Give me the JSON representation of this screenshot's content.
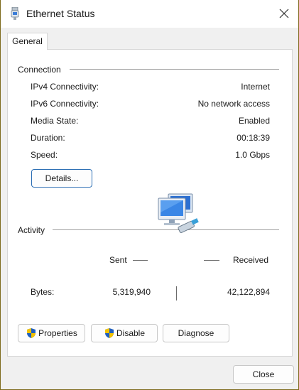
{
  "window": {
    "title": "Ethernet Status"
  },
  "tabs": [
    {
      "label": "General"
    }
  ],
  "connection": {
    "heading": "Connection",
    "rows": [
      {
        "label": "IPv4 Connectivity:",
        "value": "Internet"
      },
      {
        "label": "IPv6 Connectivity:",
        "value": "No network access"
      },
      {
        "label": "Media State:",
        "value": "Enabled"
      },
      {
        "label": "Duration:",
        "value": "00:18:39"
      },
      {
        "label": "Speed:",
        "value": "1.0 Gbps"
      }
    ],
    "details_label": "Details..."
  },
  "activity": {
    "heading": "Activity",
    "sent_label": "Sent",
    "received_label": "Received",
    "bytes_label": "Bytes:",
    "bytes_sent": "5,319,940",
    "bytes_received": "42,122,894"
  },
  "buttons": {
    "properties": "Properties",
    "disable": "Disable",
    "diagnose": "Diagnose",
    "close": "Close"
  },
  "icons": {
    "title": "ethernet-adapter-icon",
    "network": "network-computers-icon",
    "shield": "uac-shield-icon",
    "close": "close-icon"
  },
  "colors": {
    "window_border": "#7d6a1c",
    "primary_button_border": "#2a6db3",
    "shield_blue": "#1f5fbf",
    "shield_yellow": "#f2c200"
  }
}
